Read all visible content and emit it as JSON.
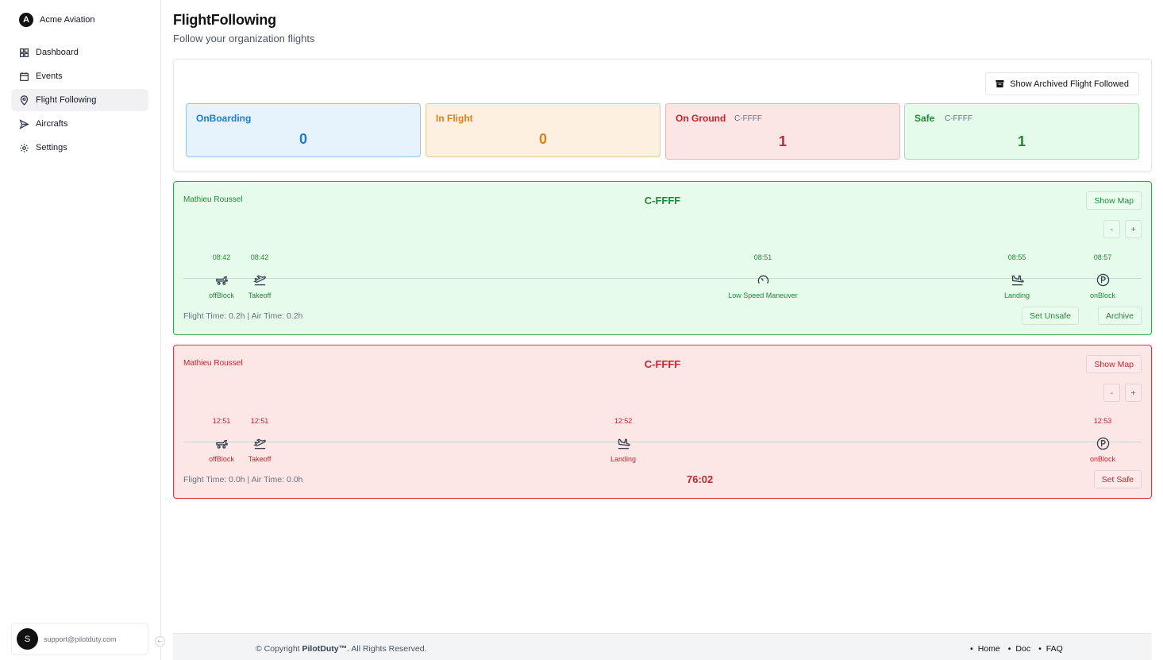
{
  "sidebar": {
    "org_name": "Acme Aviation",
    "org_initial": "A",
    "items": [
      {
        "label": "Dashboard",
        "icon": "dashboard-icon"
      },
      {
        "label": "Events",
        "icon": "calendar-icon"
      },
      {
        "label": "Flight Following",
        "icon": "map-pin-icon",
        "active": true
      },
      {
        "label": "Aircrafts",
        "icon": "send-icon"
      },
      {
        "label": "Settings",
        "icon": "gear-icon"
      }
    ],
    "user_initial": "S",
    "user_email": "support@pilotduty.com"
  },
  "header": {
    "title": "FlightFollowing",
    "subtitle": "Follow your organization flights"
  },
  "stats": {
    "archived_button": "Show Archived Flight Followed",
    "onboarding": {
      "label": "OnBoarding",
      "value": "0"
    },
    "in_flight": {
      "label": "In Flight",
      "value": "0"
    },
    "on_ground": {
      "label": "On Ground",
      "reg": "C-FFFF",
      "value": "1"
    },
    "safe": {
      "label": "Safe",
      "reg": "C-FFFF",
      "value": "1"
    }
  },
  "flights": [
    {
      "status": "safe",
      "pilot": "Mathieu Roussel",
      "registration": "C-FFFF",
      "show_map": "Show Map",
      "zoom_out": "-",
      "zoom_in": "+",
      "events": [
        {
          "time": "08:42",
          "name": "offBlock",
          "icon": "pushback-icon"
        },
        {
          "time": "08:42",
          "name": "Takeoff",
          "icon": "takeoff-icon"
        },
        {
          "time": "08:51",
          "name": "Low Speed Maneuver",
          "icon": "gauge-icon"
        },
        {
          "time": "08:55",
          "name": "Landing",
          "icon": "landing-icon"
        },
        {
          "time": "08:57",
          "name": "onBlock",
          "icon": "parking-icon"
        }
      ],
      "flight_time": "Flight Time: 0.2h | Air Time: 0.2h",
      "btn_unsafe": "Set Unsafe",
      "btn_archive": "Archive"
    },
    {
      "status": "unsafe",
      "pilot": "Mathieu Roussel",
      "registration": "C-FFFF",
      "show_map": "Show Map",
      "zoom_out": "-",
      "zoom_in": "+",
      "events": [
        {
          "time": "12:51",
          "name": "offBlock",
          "icon": "pushback-icon"
        },
        {
          "time": "12:51",
          "name": "Takeoff",
          "icon": "takeoff-icon"
        },
        {
          "time": "12:52",
          "name": "Landing",
          "icon": "landing-icon"
        },
        {
          "time": "12:53",
          "name": "onBlock",
          "icon": "parking-icon"
        }
      ],
      "flight_time": "Flight Time: 0.0h | Air Time: 0.0h",
      "timer": "76:02",
      "btn_safe": "Set Safe"
    }
  ],
  "footer": {
    "copyright_prefix": "© Copyright ",
    "brand": "PilotDuty™",
    "copyright_suffix": ". All Rights Reserved.",
    "links": [
      "Home",
      "Doc",
      "FAQ"
    ]
  }
}
